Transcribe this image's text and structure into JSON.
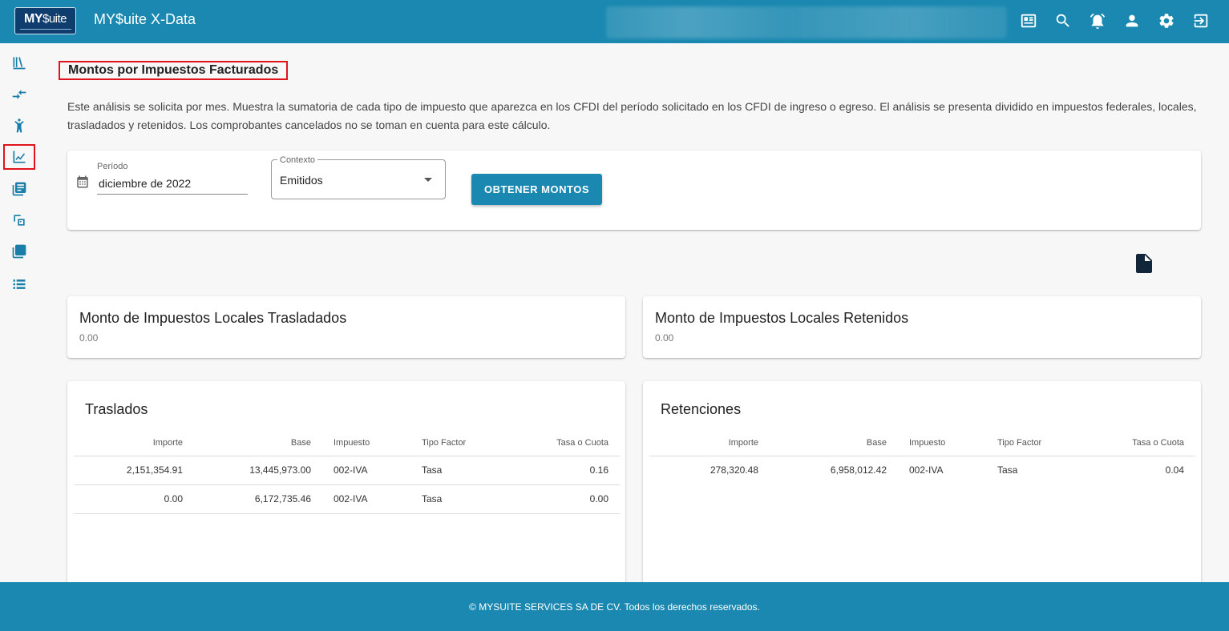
{
  "header": {
    "logo_text_bold": "MY",
    "logo_text_rest": "$uite",
    "app_title": "MY$uite X-Data",
    "icons": [
      "news-icon",
      "search-icon",
      "alarm-icon",
      "account-icon",
      "settings-icon",
      "logout-icon"
    ]
  },
  "sidebar": {
    "items": [
      "library-icon",
      "compare-arrows-icon",
      "person-icon",
      "chart-icon",
      "document-list-icon",
      "repeat-icon",
      "layers-icon",
      "list-icon"
    ],
    "active_index": 3
  },
  "page": {
    "title": "Montos por Impuestos Facturados",
    "description": "Este análisis se solicita por mes. Muestra la sumatoria de cada tipo de impuesto que aparezca en los CFDI del período solicitado en los CFDI de ingreso o egreso. El análisis se presenta dividido en impuestos federales, locales, trasladados y retenidos. Los comprobantes cancelados no se toman en cuenta para este cálculo."
  },
  "form": {
    "periodo_label": "Período",
    "periodo_value": "diciembre de 2022",
    "contexto_label": "Contexto",
    "contexto_value": "Emitidos",
    "submit_label": "OBTENER MONTOS"
  },
  "summary": {
    "locales_trasladados": {
      "title": "Monto de Impuestos Locales Trasladados",
      "value": "0.00"
    },
    "locales_retenidos": {
      "title": "Monto de Impuestos Locales Retenidos",
      "value": "0.00"
    }
  },
  "traslados": {
    "title": "Traslados",
    "columns": [
      "Importe",
      "Base",
      "Impuesto",
      "Tipo Factor",
      "Tasa o Cuota"
    ],
    "rows": [
      [
        "2,151,354.91",
        "13,445,973.00",
        "002-IVA",
        "Tasa",
        "0.16"
      ],
      [
        "0.00",
        "6,172,735.46",
        "002-IVA",
        "Tasa",
        "0.00"
      ]
    ]
  },
  "retenciones": {
    "title": "Retenciones",
    "columns": [
      "Importe",
      "Base",
      "Impuesto",
      "Tipo Factor",
      "Tasa o Cuota"
    ],
    "rows": [
      [
        "278,320.48",
        "6,958,012.42",
        "002-IVA",
        "Tasa",
        "0.04"
      ]
    ]
  },
  "footer": {
    "text": "© MYSUITE SERVICES SA DE CV. Todos los derechos reservados."
  },
  "colors": {
    "primary": "#1a88b0",
    "highlight": "#e0141e",
    "logo_bg": "#0e3d6e"
  }
}
